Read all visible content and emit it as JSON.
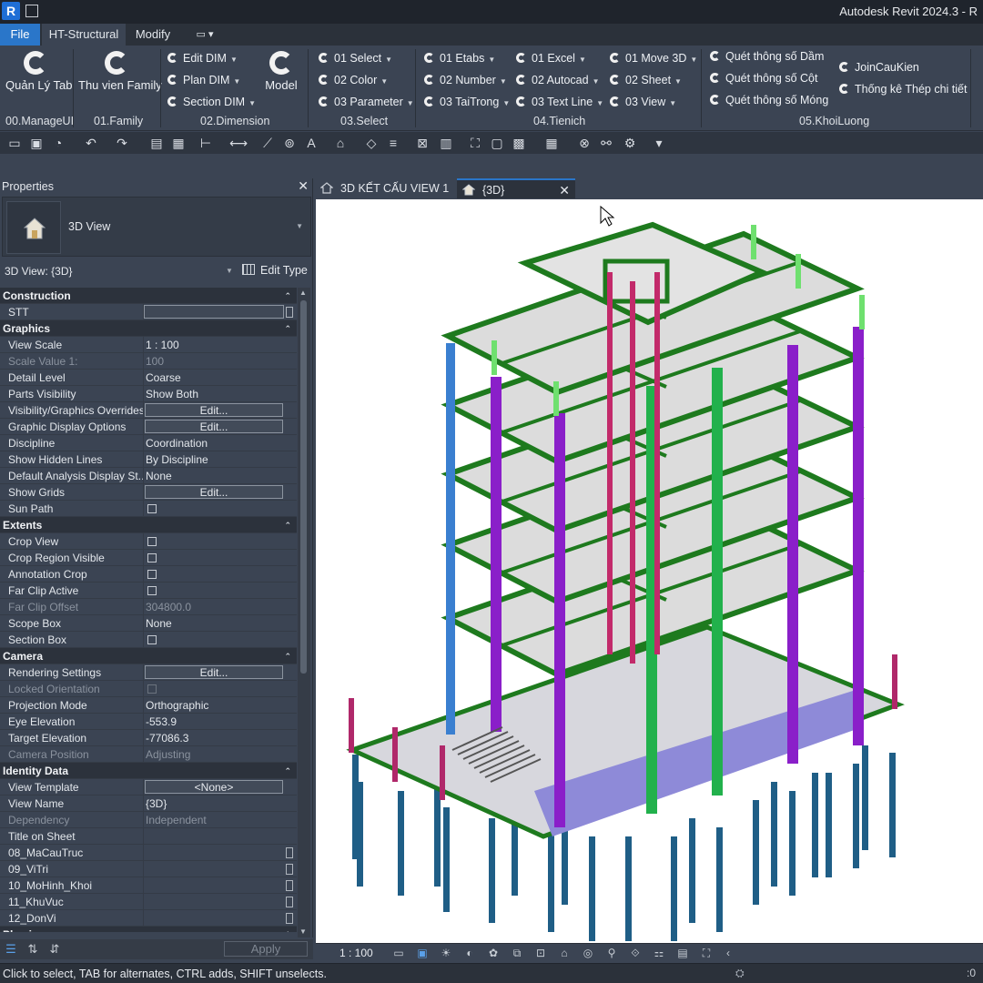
{
  "titlebar": {
    "app_icon_letter": "R",
    "title": "Autodesk Revit 2024.3 - R"
  },
  "ribbon_tabs": {
    "file": "File",
    "active": "HT-Structural",
    "modify": "Modify",
    "extra": "▭ ▾"
  },
  "ribbon": {
    "manageui": {
      "button": "Quản Lý Tab",
      "panel": "00.ManageUI"
    },
    "family": {
      "button": "Thu vien Family",
      "panel": "01.Family"
    },
    "dimension": {
      "items": [
        "Edit DIM",
        "Plan DIM",
        "Section DIM"
      ],
      "big_button": "Model",
      "panel": "02.Dimension"
    },
    "select": {
      "items": [
        "01 Select",
        "02 Color",
        "03 Parameter"
      ],
      "panel": "03.Select"
    },
    "tienich": {
      "col1": [
        "01 Etabs",
        "02 Number",
        "03 TaiTrong"
      ],
      "col2": [
        "01 Excel",
        "02 Autocad",
        "03 Text Line"
      ],
      "col3": [
        "01 Move 3D",
        "02 Sheet",
        "03 View"
      ],
      "panel": "04.Tienich"
    },
    "khoiluong": {
      "col1": [
        "Quét thông số Dầm",
        "Quét thông số Cột",
        "Quét thông số Móng"
      ],
      "col2": [
        "JoinCauKien",
        "Thống kê Thép chi tiết"
      ],
      "panel": "05.KhoiLuong"
    }
  },
  "properties": {
    "title": "Properties",
    "close": "✕",
    "type_name": "3D View",
    "instance": "3D View: {3D}",
    "edit_type": "Edit Type",
    "apply": "Apply",
    "rows": [
      {
        "group": "Construction"
      },
      {
        "k": "STT",
        "kind": "input",
        "sq": true
      },
      {
        "group": "Graphics"
      },
      {
        "k": "View Scale",
        "v": "1 : 100"
      },
      {
        "k": "Scale Value    1:",
        "v": "100",
        "dis": true
      },
      {
        "k": "Detail Level",
        "v": "Coarse"
      },
      {
        "k": "Parts Visibility",
        "v": "Show Both"
      },
      {
        "k": "Visibility/Graphics Overrides",
        "kind": "button",
        "v": "Edit..."
      },
      {
        "k": "Graphic Display Options",
        "kind": "button",
        "v": "Edit..."
      },
      {
        "k": "Discipline",
        "v": "Coordination"
      },
      {
        "k": "Show Hidden Lines",
        "v": "By Discipline"
      },
      {
        "k": "Default Analysis Display St...",
        "v": "None"
      },
      {
        "k": "Show Grids",
        "kind": "button",
        "v": "Edit..."
      },
      {
        "k": "Sun Path",
        "kind": "check"
      },
      {
        "group": "Extents"
      },
      {
        "k": "Crop View",
        "kind": "check"
      },
      {
        "k": "Crop Region Visible",
        "kind": "check"
      },
      {
        "k": "Annotation Crop",
        "kind": "check"
      },
      {
        "k": "Far Clip Active",
        "kind": "check"
      },
      {
        "k": "Far Clip Offset",
        "v": "304800.0",
        "dis": true
      },
      {
        "k": "Scope Box",
        "v": "None"
      },
      {
        "k": "Section Box",
        "kind": "check"
      },
      {
        "group": "Camera"
      },
      {
        "k": "Rendering Settings",
        "kind": "button",
        "v": "Edit..."
      },
      {
        "k": "Locked Orientation",
        "kind": "check",
        "dis": true
      },
      {
        "k": "Projection Mode",
        "v": "Orthographic"
      },
      {
        "k": "Eye Elevation",
        "v": "-553.9"
      },
      {
        "k": "Target Elevation",
        "v": "-77086.3"
      },
      {
        "k": "Camera Position",
        "v": "Adjusting",
        "dis": true
      },
      {
        "group": "Identity Data"
      },
      {
        "k": "View Template",
        "kind": "button",
        "v": "<None>"
      },
      {
        "k": "View Name",
        "v": "{3D}"
      },
      {
        "k": "Dependency",
        "v": "Independent",
        "dis": true
      },
      {
        "k": "Title on Sheet",
        "v": ""
      },
      {
        "k": "08_MaCauTruc",
        "v": "",
        "sq": true
      },
      {
        "k": "09_ViTri",
        "v": "",
        "sq": true
      },
      {
        "k": "10_MoHinh_Khoi",
        "v": "",
        "sq": true
      },
      {
        "k": "11_KhuVuc",
        "v": "",
        "sq": true
      },
      {
        "k": "12_DonVi",
        "v": "",
        "sq": true
      },
      {
        "group": "Phasing"
      }
    ]
  },
  "view_tabs": [
    {
      "label": "3D KẾT CẤU VIEW 1"
    },
    {
      "label": "{3D}",
      "close": "✕"
    }
  ],
  "view_control": {
    "scale": "1 : 100"
  },
  "statusbar": {
    "message": "Click to select, TAB for alternates, CTRL adds, SHIFT unselects.",
    "selection_count": ":0"
  },
  "colors": {
    "beam_green": "#1e7a1e",
    "column_purple": "#8a1fc9",
    "column_blue": "#3a7fd0",
    "column_green": "#22b14c",
    "pile_blue": "#1f5e86",
    "slab_gray": "#dcdcdc",
    "accent_blue": "#2a76c9"
  }
}
